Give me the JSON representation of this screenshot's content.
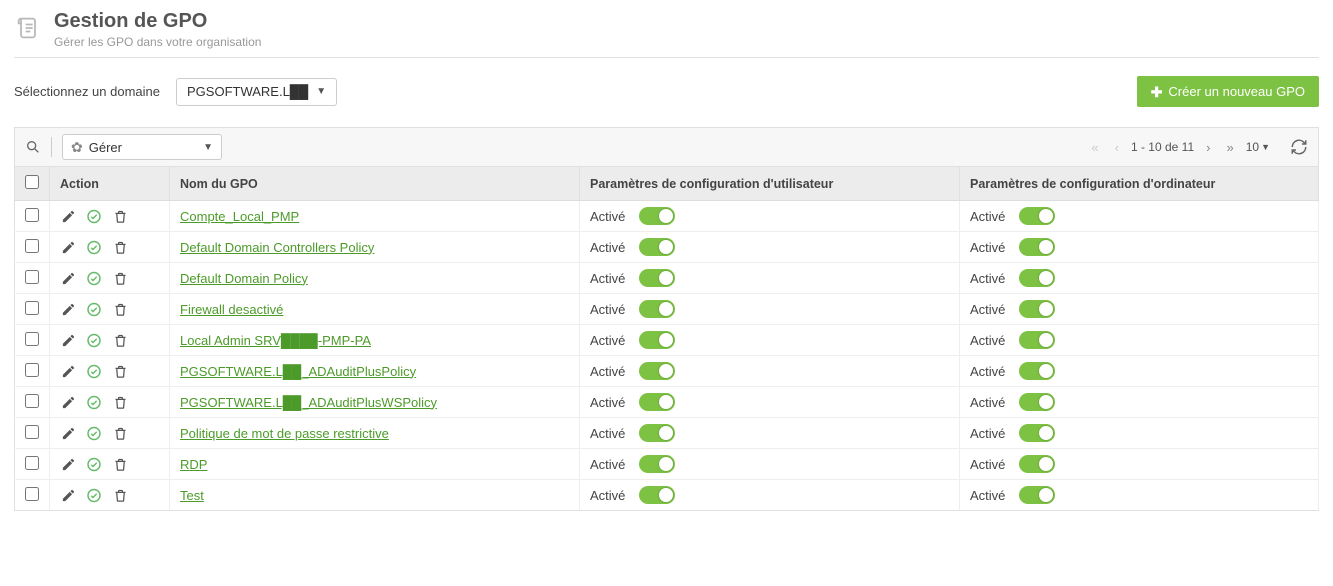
{
  "header": {
    "title": "Gestion de GPO",
    "subtitle": "Gérer les GPO dans votre organisation"
  },
  "domain": {
    "label": "Sélectionnez un domaine",
    "selected": "PGSOFTWARE.L██"
  },
  "create_button": "Créer un nouveau GPO",
  "toolbar": {
    "manage_label": "Gérer",
    "pagination_text": "1 - 10 de  11",
    "page_size": "10"
  },
  "columns": {
    "action": "Action",
    "name": "Nom du GPO",
    "user": "Paramètres de configuration d'utilisateur",
    "comp": "Paramètres de configuration d'ordinateur"
  },
  "status_label": "Activé",
  "rows": [
    {
      "name": "Compte_Local_PMP",
      "user_enabled": true,
      "comp_enabled": true
    },
    {
      "name": "Default Domain Controllers Policy",
      "user_enabled": true,
      "comp_enabled": true
    },
    {
      "name": "Default Domain Policy",
      "user_enabled": true,
      "comp_enabled": true
    },
    {
      "name": "Firewall desactivé",
      "user_enabled": true,
      "comp_enabled": true
    },
    {
      "name": "Local Admin SRV████-PMP-PA",
      "user_enabled": true,
      "comp_enabled": true
    },
    {
      "name": "PGSOFTWARE.L██_ADAuditPlusPolicy",
      "user_enabled": true,
      "comp_enabled": true
    },
    {
      "name": "PGSOFTWARE.L██_ADAuditPlusWSPolicy",
      "user_enabled": true,
      "comp_enabled": true
    },
    {
      "name": "Politique de mot de passe restrictive",
      "user_enabled": true,
      "comp_enabled": true
    },
    {
      "name": "RDP",
      "user_enabled": true,
      "comp_enabled": true
    },
    {
      "name": "Test",
      "user_enabled": true,
      "comp_enabled": true
    }
  ]
}
